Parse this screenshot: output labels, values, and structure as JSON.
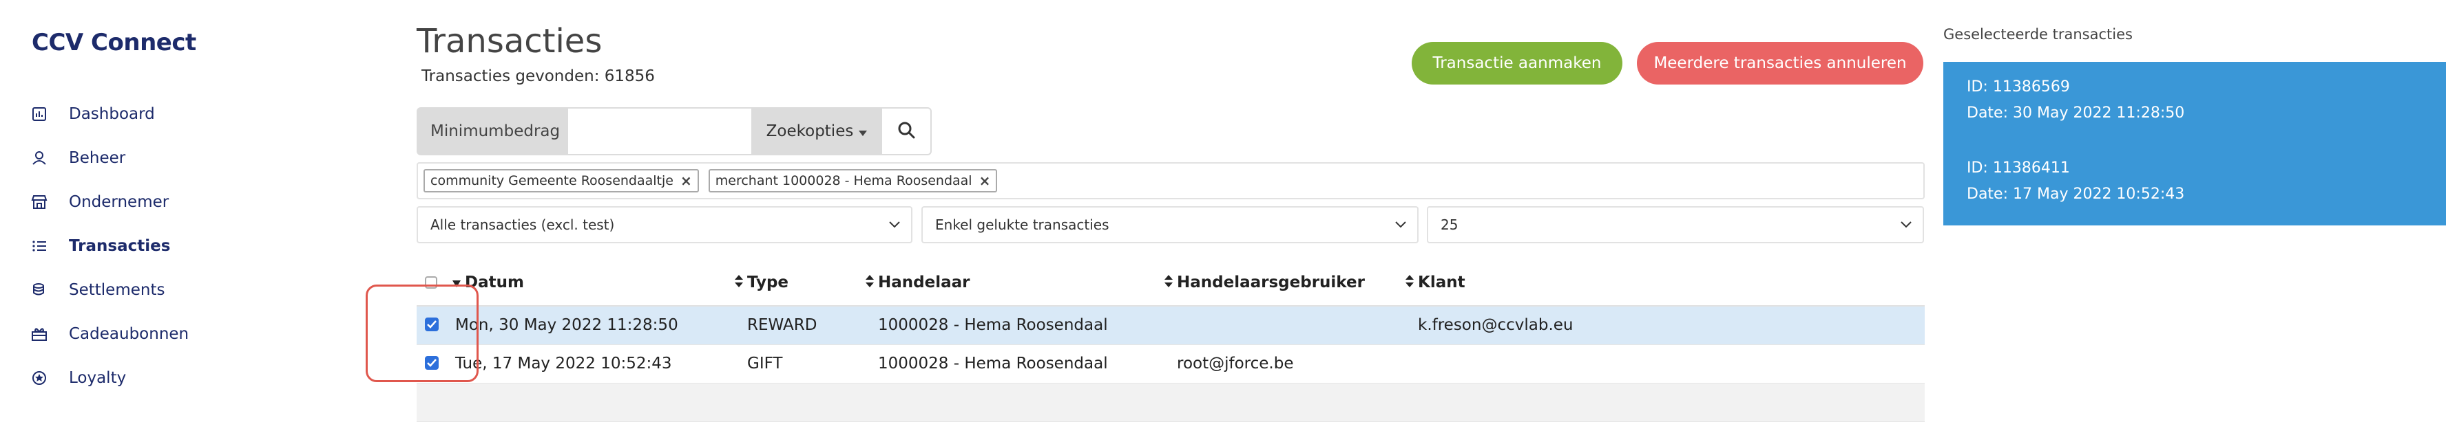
{
  "sidebar": {
    "brand": "CCV Connect",
    "items": [
      {
        "label": "Dashboard",
        "icon": "chart-icon"
      },
      {
        "label": "Beheer",
        "icon": "user-icon"
      },
      {
        "label": "Ondernemer",
        "icon": "store-icon"
      },
      {
        "label": "Transacties",
        "icon": "list-icon",
        "active": true
      },
      {
        "label": "Settlements",
        "icon": "coins-icon"
      },
      {
        "label": "Cadeaubonnen",
        "icon": "gift-icon"
      },
      {
        "label": "Loyalty",
        "icon": "star-icon"
      }
    ]
  },
  "header": {
    "title": "Transacties",
    "found": "Transacties gevonden: 61856",
    "create_button": "Transactie aanmaken",
    "cancel_button": "Meerdere transacties annuleren"
  },
  "search": {
    "min_label": "Minimumbedrag",
    "min_value": "",
    "options_label": "Zoekopties"
  },
  "tags": [
    "community Gemeente Roosendaaltje",
    "merchant 1000028 - Hema Roosendaal"
  ],
  "filters": {
    "transactions": "Alle transacties (excl. test)",
    "status": "Enkel gelukte transacties",
    "page_size": "25"
  },
  "table": {
    "headers": [
      "Datum",
      "Type",
      "Handelaar",
      "Handelaarsgebruiker",
      "Klant"
    ],
    "rows": [
      {
        "date": "Mon, 30 May 2022 11:28:50",
        "type": "REWARD",
        "merchant": "1000028 - Hema Roosendaal",
        "merchant_user": "",
        "client": "k.freson@ccvlab.eu",
        "checked": true
      },
      {
        "date": "Tue, 17 May 2022 10:52:43",
        "type": "GIFT",
        "merchant": "1000028 - Hema Roosendaal",
        "merchant_user": "root@jforce.be",
        "client": "",
        "checked": true
      }
    ]
  },
  "selected": {
    "title": "Geselecteerde transacties",
    "items": [
      {
        "id": "ID: 11386569",
        "date": "Date: 30 May 2022 11:28:50"
      },
      {
        "id": "ID: 11386411",
        "date": "Date: 17 May 2022 10:52:43"
      }
    ]
  },
  "colors": {
    "brand": "#1d2b6b",
    "green": "#82b43a",
    "red": "#ea6464",
    "selected_blue": "#3a97d7",
    "row_highlight": "#d9e9f7",
    "annotation": "#e0574d"
  }
}
